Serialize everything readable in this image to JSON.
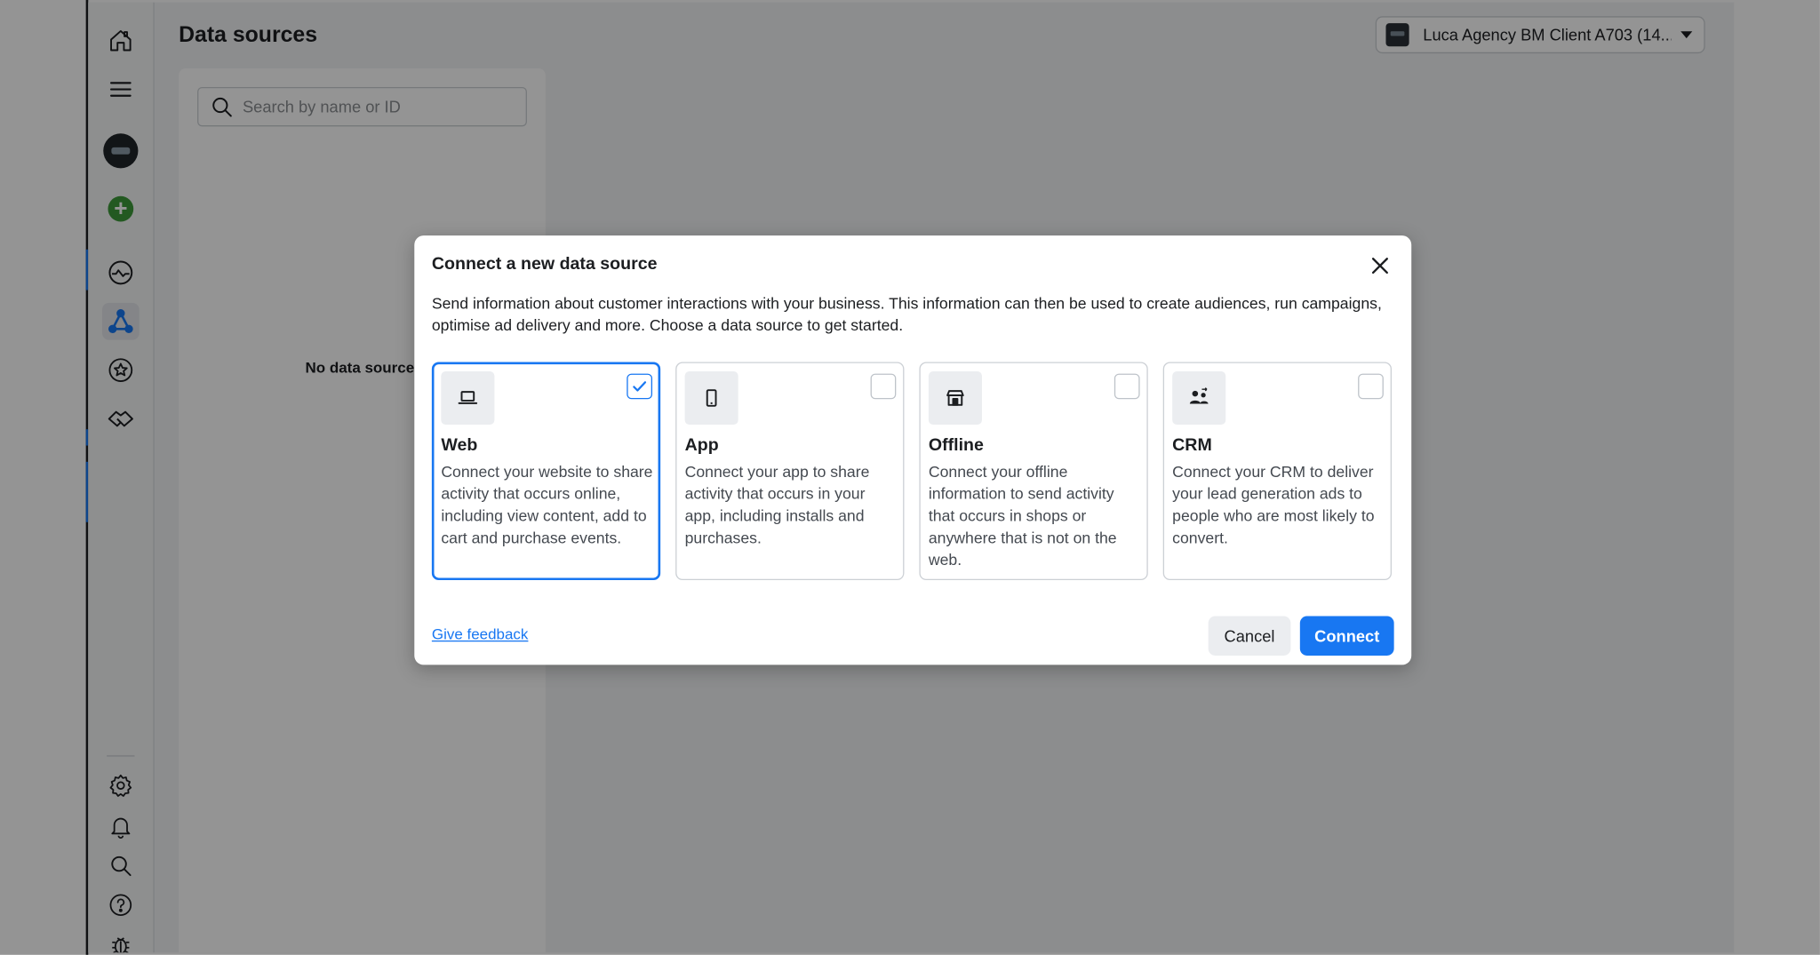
{
  "page": {
    "title": "Data sources"
  },
  "account_selector": {
    "label": "Luca Agency BM Client A703 (14..."
  },
  "search": {
    "placeholder": "Search by name or ID"
  },
  "list": {
    "empty_text": "No data sources"
  },
  "sidebar": {
    "top_icons": [
      "home-icon",
      "menu-icon",
      "account-avatar",
      "create-icon",
      "dashboard-icon",
      "data-sources-icon",
      "star-icon",
      "handshake-icon"
    ],
    "bottom_icons": [
      "settings-icon",
      "bell-icon",
      "search-icon",
      "help-icon",
      "bug-icon"
    ],
    "active_item": "data-sources-icon"
  },
  "dialog": {
    "title": "Connect a new data source",
    "description": "Send information about customer interactions with your business. This information can then be used to create audiences, run campaigns, optimise ad delivery and more. Choose a data source to get started.",
    "options": [
      {
        "title": "Web",
        "description": "Connect your website to share activity that occurs online, including view content, add to cart and purchase events.",
        "icon": "laptop-icon",
        "selected": true
      },
      {
        "title": "App",
        "description": "Connect your app to share activity that occurs in your app, including installs and purchases.",
        "icon": "phone-icon",
        "selected": false
      },
      {
        "title": "Offline",
        "description": "Connect your offline information to send activity that occurs in shops or anywhere that is not on the web.",
        "icon": "store-icon",
        "selected": false
      },
      {
        "title": "CRM",
        "description": "Connect your CRM to deliver your lead generation ads to people who are most likely to convert.",
        "icon": "people-icon",
        "selected": false
      }
    ],
    "feedback_link": "Give feedback",
    "cancel_label": "Cancel",
    "connect_label": "Connect"
  },
  "colors": {
    "accent": "#1877f2",
    "create_green": "#3d9a3a",
    "overlay": "rgba(0,0,0,0.42)"
  }
}
